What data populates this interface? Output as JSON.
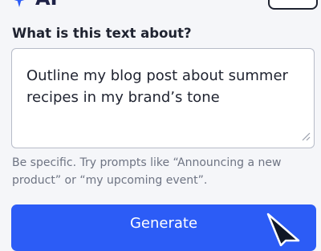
{
  "header": {
    "title": "AI",
    "icon": "sparkles-icon",
    "accent": "#2c5cf6"
  },
  "form": {
    "question": "What is this text about?",
    "prompt_value": "Outline my blog post about summer recipes in my brand’s tone",
    "helper": "Be specific. Try prompts like “Announcing a new product” or “my upcoming event”."
  },
  "actions": {
    "generate_label": "Generate",
    "generate_color": "#2c5cf6"
  },
  "cursor": {
    "icon": "mouse-pointer-icon"
  }
}
